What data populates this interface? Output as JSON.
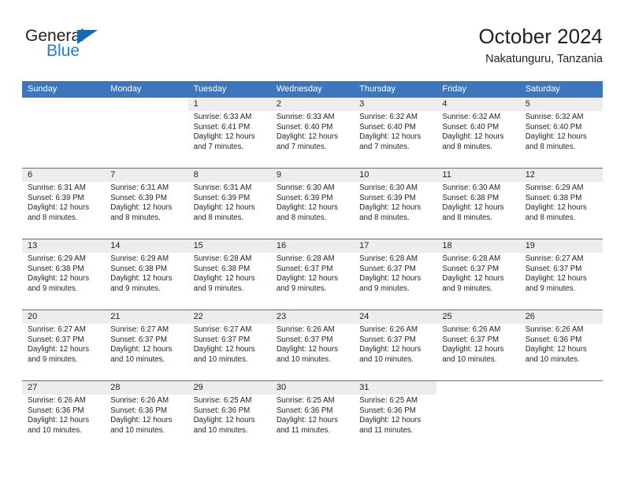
{
  "brand": {
    "name_top": "General",
    "name_bottom": "Blue",
    "triangle_color": "#1669b5",
    "blue_color": "#1b7fd4"
  },
  "header": {
    "title": "October 2024",
    "subtitle": "Nakatunguru, Tanzania"
  },
  "theme": {
    "header_blue": "#3c77be",
    "daystrip_gray": "#ededed",
    "text": "#231f20"
  },
  "weekdays": [
    "Sunday",
    "Monday",
    "Tuesday",
    "Wednesday",
    "Thursday",
    "Friday",
    "Saturday"
  ],
  "weeks": [
    [
      {
        "day": "",
        "lines": []
      },
      {
        "day": "",
        "lines": []
      },
      {
        "day": "1",
        "lines": [
          "Sunrise: 6:33 AM",
          "Sunset: 6:41 PM",
          "Daylight: 12 hours",
          "and 7 minutes."
        ]
      },
      {
        "day": "2",
        "lines": [
          "Sunrise: 6:33 AM",
          "Sunset: 6:40 PM",
          "Daylight: 12 hours",
          "and 7 minutes."
        ]
      },
      {
        "day": "3",
        "lines": [
          "Sunrise: 6:32 AM",
          "Sunset: 6:40 PM",
          "Daylight: 12 hours",
          "and 7 minutes."
        ]
      },
      {
        "day": "4",
        "lines": [
          "Sunrise: 6:32 AM",
          "Sunset: 6:40 PM",
          "Daylight: 12 hours",
          "and 8 minutes."
        ]
      },
      {
        "day": "5",
        "lines": [
          "Sunrise: 6:32 AM",
          "Sunset: 6:40 PM",
          "Daylight: 12 hours",
          "and 8 minutes."
        ]
      }
    ],
    [
      {
        "day": "6",
        "lines": [
          "Sunrise: 6:31 AM",
          "Sunset: 6:39 PM",
          "Daylight: 12 hours",
          "and 8 minutes."
        ]
      },
      {
        "day": "7",
        "lines": [
          "Sunrise: 6:31 AM",
          "Sunset: 6:39 PM",
          "Daylight: 12 hours",
          "and 8 minutes."
        ]
      },
      {
        "day": "8",
        "lines": [
          "Sunrise: 6:31 AM",
          "Sunset: 6:39 PM",
          "Daylight: 12 hours",
          "and 8 minutes."
        ]
      },
      {
        "day": "9",
        "lines": [
          "Sunrise: 6:30 AM",
          "Sunset: 6:39 PM",
          "Daylight: 12 hours",
          "and 8 minutes."
        ]
      },
      {
        "day": "10",
        "lines": [
          "Sunrise: 6:30 AM",
          "Sunset: 6:39 PM",
          "Daylight: 12 hours",
          "and 8 minutes."
        ]
      },
      {
        "day": "11",
        "lines": [
          "Sunrise: 6:30 AM",
          "Sunset: 6:38 PM",
          "Daylight: 12 hours",
          "and 8 minutes."
        ]
      },
      {
        "day": "12",
        "lines": [
          "Sunrise: 6:29 AM",
          "Sunset: 6:38 PM",
          "Daylight: 12 hours",
          "and 8 minutes."
        ]
      }
    ],
    [
      {
        "day": "13",
        "lines": [
          "Sunrise: 6:29 AM",
          "Sunset: 6:38 PM",
          "Daylight: 12 hours",
          "and 9 minutes."
        ]
      },
      {
        "day": "14",
        "lines": [
          "Sunrise: 6:29 AM",
          "Sunset: 6:38 PM",
          "Daylight: 12 hours",
          "and 9 minutes."
        ]
      },
      {
        "day": "15",
        "lines": [
          "Sunrise: 6:28 AM",
          "Sunset: 6:38 PM",
          "Daylight: 12 hours",
          "and 9 minutes."
        ]
      },
      {
        "day": "16",
        "lines": [
          "Sunrise: 6:28 AM",
          "Sunset: 6:37 PM",
          "Daylight: 12 hours",
          "and 9 minutes."
        ]
      },
      {
        "day": "17",
        "lines": [
          "Sunrise: 6:28 AM",
          "Sunset: 6:37 PM",
          "Daylight: 12 hours",
          "and 9 minutes."
        ]
      },
      {
        "day": "18",
        "lines": [
          "Sunrise: 6:28 AM",
          "Sunset: 6:37 PM",
          "Daylight: 12 hours",
          "and 9 minutes."
        ]
      },
      {
        "day": "19",
        "lines": [
          "Sunrise: 6:27 AM",
          "Sunset: 6:37 PM",
          "Daylight: 12 hours",
          "and 9 minutes."
        ]
      }
    ],
    [
      {
        "day": "20",
        "lines": [
          "Sunrise: 6:27 AM",
          "Sunset: 6:37 PM",
          "Daylight: 12 hours",
          "and 9 minutes."
        ]
      },
      {
        "day": "21",
        "lines": [
          "Sunrise: 6:27 AM",
          "Sunset: 6:37 PM",
          "Daylight: 12 hours",
          "and 10 minutes."
        ]
      },
      {
        "day": "22",
        "lines": [
          "Sunrise: 6:27 AM",
          "Sunset: 6:37 PM",
          "Daylight: 12 hours",
          "and 10 minutes."
        ]
      },
      {
        "day": "23",
        "lines": [
          "Sunrise: 6:26 AM",
          "Sunset: 6:37 PM",
          "Daylight: 12 hours",
          "and 10 minutes."
        ]
      },
      {
        "day": "24",
        "lines": [
          "Sunrise: 6:26 AM",
          "Sunset: 6:37 PM",
          "Daylight: 12 hours",
          "and 10 minutes."
        ]
      },
      {
        "day": "25",
        "lines": [
          "Sunrise: 6:26 AM",
          "Sunset: 6:37 PM",
          "Daylight: 12 hours",
          "and 10 minutes."
        ]
      },
      {
        "day": "26",
        "lines": [
          "Sunrise: 6:26 AM",
          "Sunset: 6:36 PM",
          "Daylight: 12 hours",
          "and 10 minutes."
        ]
      }
    ],
    [
      {
        "day": "27",
        "lines": [
          "Sunrise: 6:26 AM",
          "Sunset: 6:36 PM",
          "Daylight: 12 hours",
          "and 10 minutes."
        ]
      },
      {
        "day": "28",
        "lines": [
          "Sunrise: 6:26 AM",
          "Sunset: 6:36 PM",
          "Daylight: 12 hours",
          "and 10 minutes."
        ]
      },
      {
        "day": "29",
        "lines": [
          "Sunrise: 6:25 AM",
          "Sunset: 6:36 PM",
          "Daylight: 12 hours",
          "and 10 minutes."
        ]
      },
      {
        "day": "30",
        "lines": [
          "Sunrise: 6:25 AM",
          "Sunset: 6:36 PM",
          "Daylight: 12 hours",
          "and 11 minutes."
        ]
      },
      {
        "day": "31",
        "lines": [
          "Sunrise: 6:25 AM",
          "Sunset: 6:36 PM",
          "Daylight: 12 hours",
          "and 11 minutes."
        ]
      },
      {
        "day": "",
        "lines": []
      },
      {
        "day": "",
        "lines": []
      }
    ]
  ]
}
